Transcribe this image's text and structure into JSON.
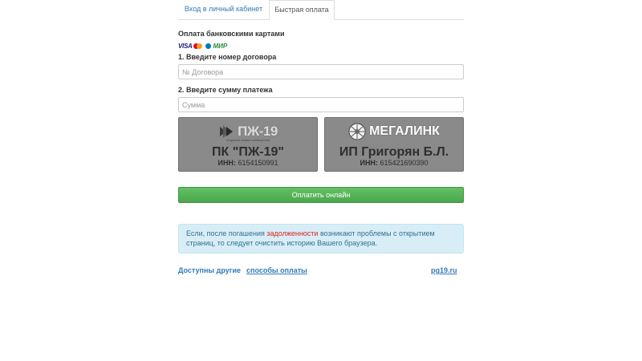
{
  "tabs": {
    "login": "Вход в личный кабинет",
    "quick_pay": "Быстрая оплата"
  },
  "payment": {
    "section_title": "Оплата банковскими картами",
    "cards": {
      "visa": "VISA",
      "mir": "МИР"
    },
    "contract_label": "1. Введите номер договора",
    "contract_placeholder": "№ Договора",
    "amount_label": "2. Введите сумму платежа",
    "amount_placeholder": "Сумма"
  },
  "merchants": [
    {
      "logo": "ПЖ-19",
      "logo_sub": "открытие нового сообщества",
      "name": "ПК \"ПЖ-19\"",
      "inn_label": "ИНН:",
      "inn": "6154150991"
    },
    {
      "logo": "МЕГАЛИНК",
      "name": "ИП Григорян Б.Л.",
      "inn_label": "ИНН:",
      "inn": "615421690390"
    }
  ],
  "pay_button": "Оплатить онлайн",
  "alert": {
    "part1": "Если, после погашения ",
    "highlight": "задолженности",
    "part2": " возникают проблемы с открытием страниц, то следует очистить историю Вашего браузера."
  },
  "footer": {
    "other_text": "Доступны другие",
    "other_link": "способы оплаты",
    "site_link": "pg19.ru"
  },
  "colors": {
    "link": "#337ab7",
    "button_green": "#4aa84c",
    "alert_bg": "#d9edf7",
    "alert_highlight": "#d9261c"
  }
}
